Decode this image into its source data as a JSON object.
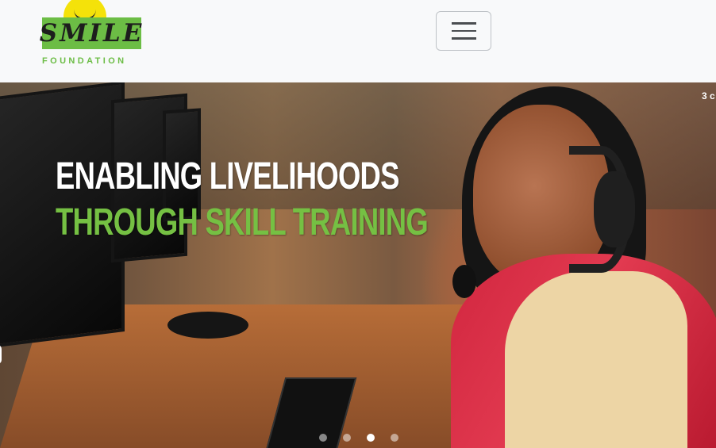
{
  "brand": {
    "name": "SMILE",
    "subtitle": "FOUNDATION",
    "colors": {
      "green": "#6cbd45",
      "yellow": "#f4e20a",
      "text": "#1d1d1d"
    }
  },
  "navbar": {
    "toggle_icon": "hamburger-icon"
  },
  "carousel": {
    "counter_fragment": "3 c",
    "headline": {
      "line1": "ENABLING LIVELIHOODS",
      "line2": "THROUGH SKILL TRAINING"
    },
    "indicators": [
      {
        "active": false
      },
      {
        "active": false
      },
      {
        "active": true
      },
      {
        "active": false
      }
    ],
    "accent_colors": {
      "headline_green": "#75c043",
      "saree_red": "#d1263f"
    }
  }
}
